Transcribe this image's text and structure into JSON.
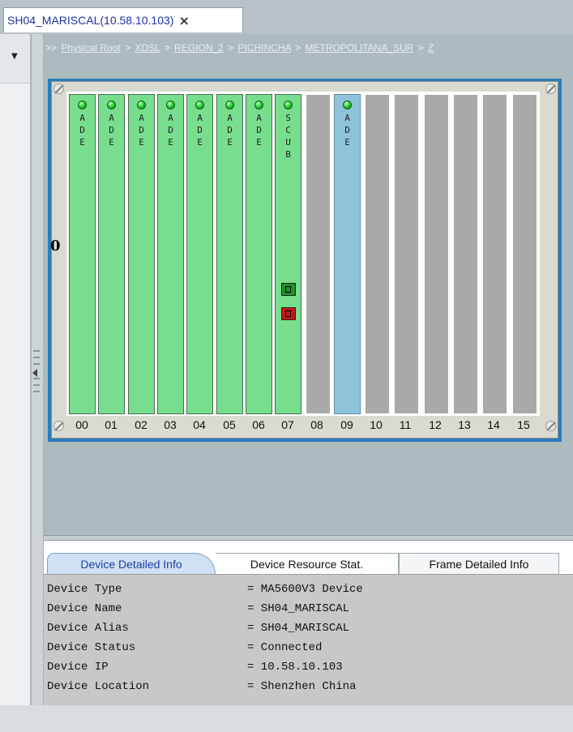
{
  "tab": {
    "title": "SH04_MARISCAL(10.58.10.103)",
    "close": "×"
  },
  "sidebar": {
    "dropdown_icon": "chevron-down-icon"
  },
  "breadcrumb": {
    "prefix": ">>",
    "items": [
      "Physical Root",
      "XDSL",
      "REGION_2",
      "PICHINCHA",
      "METROPOLITANA_SUR",
      "Z"
    ],
    "separator": ">"
  },
  "shelf": {
    "label": "0",
    "slots": [
      {
        "num": "00",
        "board": "ADE",
        "state": "ade"
      },
      {
        "num": "01",
        "board": "ADE",
        "state": "ade"
      },
      {
        "num": "02",
        "board": "ADE",
        "state": "ade"
      },
      {
        "num": "03",
        "board": "ADE",
        "state": "ade"
      },
      {
        "num": "04",
        "board": "ADE",
        "state": "ade"
      },
      {
        "num": "05",
        "board": "ADE",
        "state": "ade"
      },
      {
        "num": "06",
        "board": "ADE",
        "state": "ade"
      },
      {
        "num": "07",
        "board": "SCUB",
        "state": "ade"
      },
      {
        "num": "08",
        "board": "",
        "state": "empty"
      },
      {
        "num": "09",
        "board": "ADE",
        "state": "selected"
      },
      {
        "num": "10",
        "board": "",
        "state": "empty"
      },
      {
        "num": "11",
        "board": "",
        "state": "empty"
      },
      {
        "num": "12",
        "board": "",
        "state": "empty"
      },
      {
        "num": "13",
        "board": "",
        "state": "empty"
      },
      {
        "num": "14",
        "board": "",
        "state": "empty"
      },
      {
        "num": "15",
        "board": "",
        "state": "empty"
      }
    ]
  },
  "bottom_tabs": [
    "Device Detailed Info",
    "Device Resource Stat.",
    "Frame Detailed Info"
  ],
  "device_info": [
    {
      "key": "Device Type",
      "value": "= MA5600V3 Device"
    },
    {
      "key": "Device Name",
      "value": "= SH04_MARISCAL"
    },
    {
      "key": "Device Alias",
      "value": "= SH04_MARISCAL"
    },
    {
      "key": "Device Status",
      "value": "= Connected"
    },
    {
      "key": "Device IP",
      "value": "= 10.58.10.103"
    },
    {
      "key": "Device Location",
      "value": "= Shenzhen China"
    }
  ],
  "colors": {
    "board_green": "#78de8e",
    "board_selected": "#8fc3dc",
    "empty_slot": "#a9a9a9",
    "rack_border": "#2a7dba",
    "tab_text": "#1a33a0"
  }
}
